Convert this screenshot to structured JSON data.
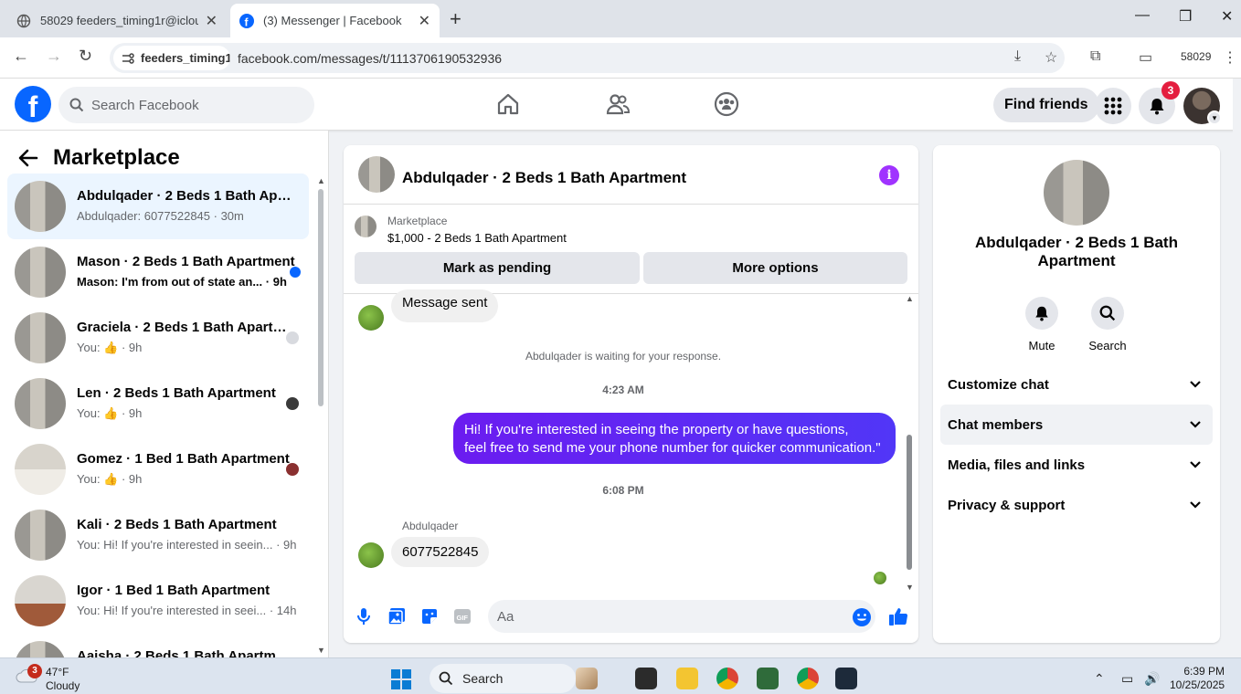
{
  "browser": {
    "tabs": [
      {
        "title": "58029 feeders_timing1r@icloud",
        "active": false
      },
      {
        "title": "(3) Messenger | Facebook",
        "active": true
      }
    ],
    "site_chip": "feeders_timing1...",
    "url": "facebook.com/messages/t/1113706190532936",
    "profile_label": "58029"
  },
  "fb_nav": {
    "search_placeholder": "Search Facebook",
    "find_friends": "Find friends",
    "notification_count": "3"
  },
  "sidebar": {
    "title": "Marketplace",
    "conversations": [
      {
        "name": "Abdulqader · 2 Beds 1 Bath Apartment",
        "preview": "Abdulqader: 6077522845 · 30m",
        "selected": true,
        "unread": false
      },
      {
        "name": "Mason · 2 Beds 1 Bath Apartment",
        "preview": "Mason: I'm from out of state an... · 9h",
        "unread": true
      },
      {
        "name": "Graciela · 2 Beds 1 Bath Apartment",
        "preview": "You: 👍 · 9h",
        "unread": false
      },
      {
        "name": "Len · 2 Beds 1 Bath Apartment",
        "preview": "You: 👍 · 9h",
        "unread": false
      },
      {
        "name": "Gomez · 1 Bed 1 Bath Apartment",
        "preview": "You: 👍 · 9h",
        "unread": false
      },
      {
        "name": "Kali · 2 Beds 1 Bath Apartment",
        "preview": "You: Hi! If you're interested in seein... · 9h",
        "unread": false
      },
      {
        "name": "Igor · 1 Bed 1 Bath Apartment",
        "preview": "You: Hi! If you're interested in seei... · 14h",
        "unread": false
      },
      {
        "name": "Aaisha · 2 Beds 1 Bath Apartment",
        "preview": "",
        "unread": false
      }
    ]
  },
  "chat": {
    "title": "Abdulqader · 2 Beds 1 Bath Apartment",
    "listing_label": "Marketplace",
    "listing_title": "$1,000 - 2 Beds 1 Bath Apartment",
    "mark_pending": "Mark as pending",
    "more_options": "More options",
    "messages": {
      "sent_status": "Message sent",
      "waiting": "Abdulqader is waiting for your response.",
      "time1": "4:23 AM",
      "outgoing_line1": "Hi! If you're interested in seeing the property or have questions,",
      "outgoing_line2": "feel free to send me your phone number for quicker communication.\"",
      "time2": "6:08 PM",
      "sender": "Abdulqader",
      "incoming": "6077522845"
    },
    "composer_placeholder": "Aa"
  },
  "info_panel": {
    "name": "Abdulqader · 2 Beds 1 Bath Apartment",
    "mute": "Mute",
    "search": "Search",
    "sections": [
      "Customize chat",
      "Chat members",
      "Media, files and links",
      "Privacy & support"
    ]
  },
  "taskbar": {
    "weather_badge": "3",
    "temp": "47°F",
    "condition": "Cloudy",
    "search": "Search",
    "time": "6:39 PM",
    "date": "10/25/2025"
  },
  "colors": {
    "fb_blue": "#0866ff",
    "messenger_purple": "#5b2ff5",
    "selected_bg": "#ebf5ff",
    "unread_dot": "#0866ff"
  }
}
